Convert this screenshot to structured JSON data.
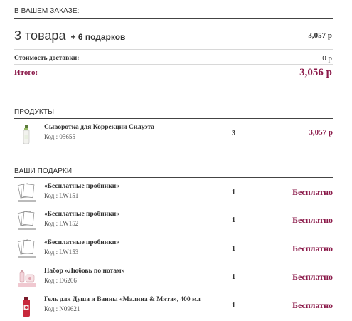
{
  "order_summary": {
    "title": "В ВАШЕМ ЗАКАЗЕ:",
    "count_label": "3 товара",
    "gifts_label": "+ 6 подарков",
    "subtotal": "3,057 р",
    "shipping_label": "Стоимость доставки:",
    "shipping_value": "0 р",
    "total_label": "Итого:",
    "total_value": "3,056 р"
  },
  "products": {
    "title": "ПРОДУКТЫ",
    "items": [
      {
        "name": "Сыворотка для Коррекции Силуэта",
        "code": "Код : 05655",
        "qty": "3",
        "price": "3,057 р",
        "icon": "serum-bottle-icon"
      }
    ]
  },
  "gifts": {
    "title": "ВАШИ ПОДАРКИ",
    "items": [
      {
        "name": "«Бесплатные пробники»",
        "code": "Код : LW151",
        "qty": "1",
        "price": "Бесплатно",
        "icon": "samples-pack-icon"
      },
      {
        "name": "«Бесплатные пробники»",
        "code": "Код : LW152",
        "qty": "1",
        "price": "Бесплатно",
        "icon": "samples-pack-icon"
      },
      {
        "name": "«Бесплатные пробники»",
        "code": "Код : LW153",
        "qty": "1",
        "price": "Бесплатно",
        "icon": "samples-pack-icon"
      },
      {
        "name": "Набор «Любовь по нотам»",
        "code": "Код : D6206",
        "qty": "1",
        "price": "Бесплатно",
        "icon": "gift-set-icon"
      },
      {
        "name": "Гель для Душа и Ванны «Малина & Мята», 400 мл",
        "code": "Код : N09621",
        "qty": "1",
        "price": "Бесплатно",
        "icon": "shower-gel-bottle-icon"
      }
    ]
  },
  "colors": {
    "accent": "#8b1a4a",
    "text": "#333333"
  }
}
